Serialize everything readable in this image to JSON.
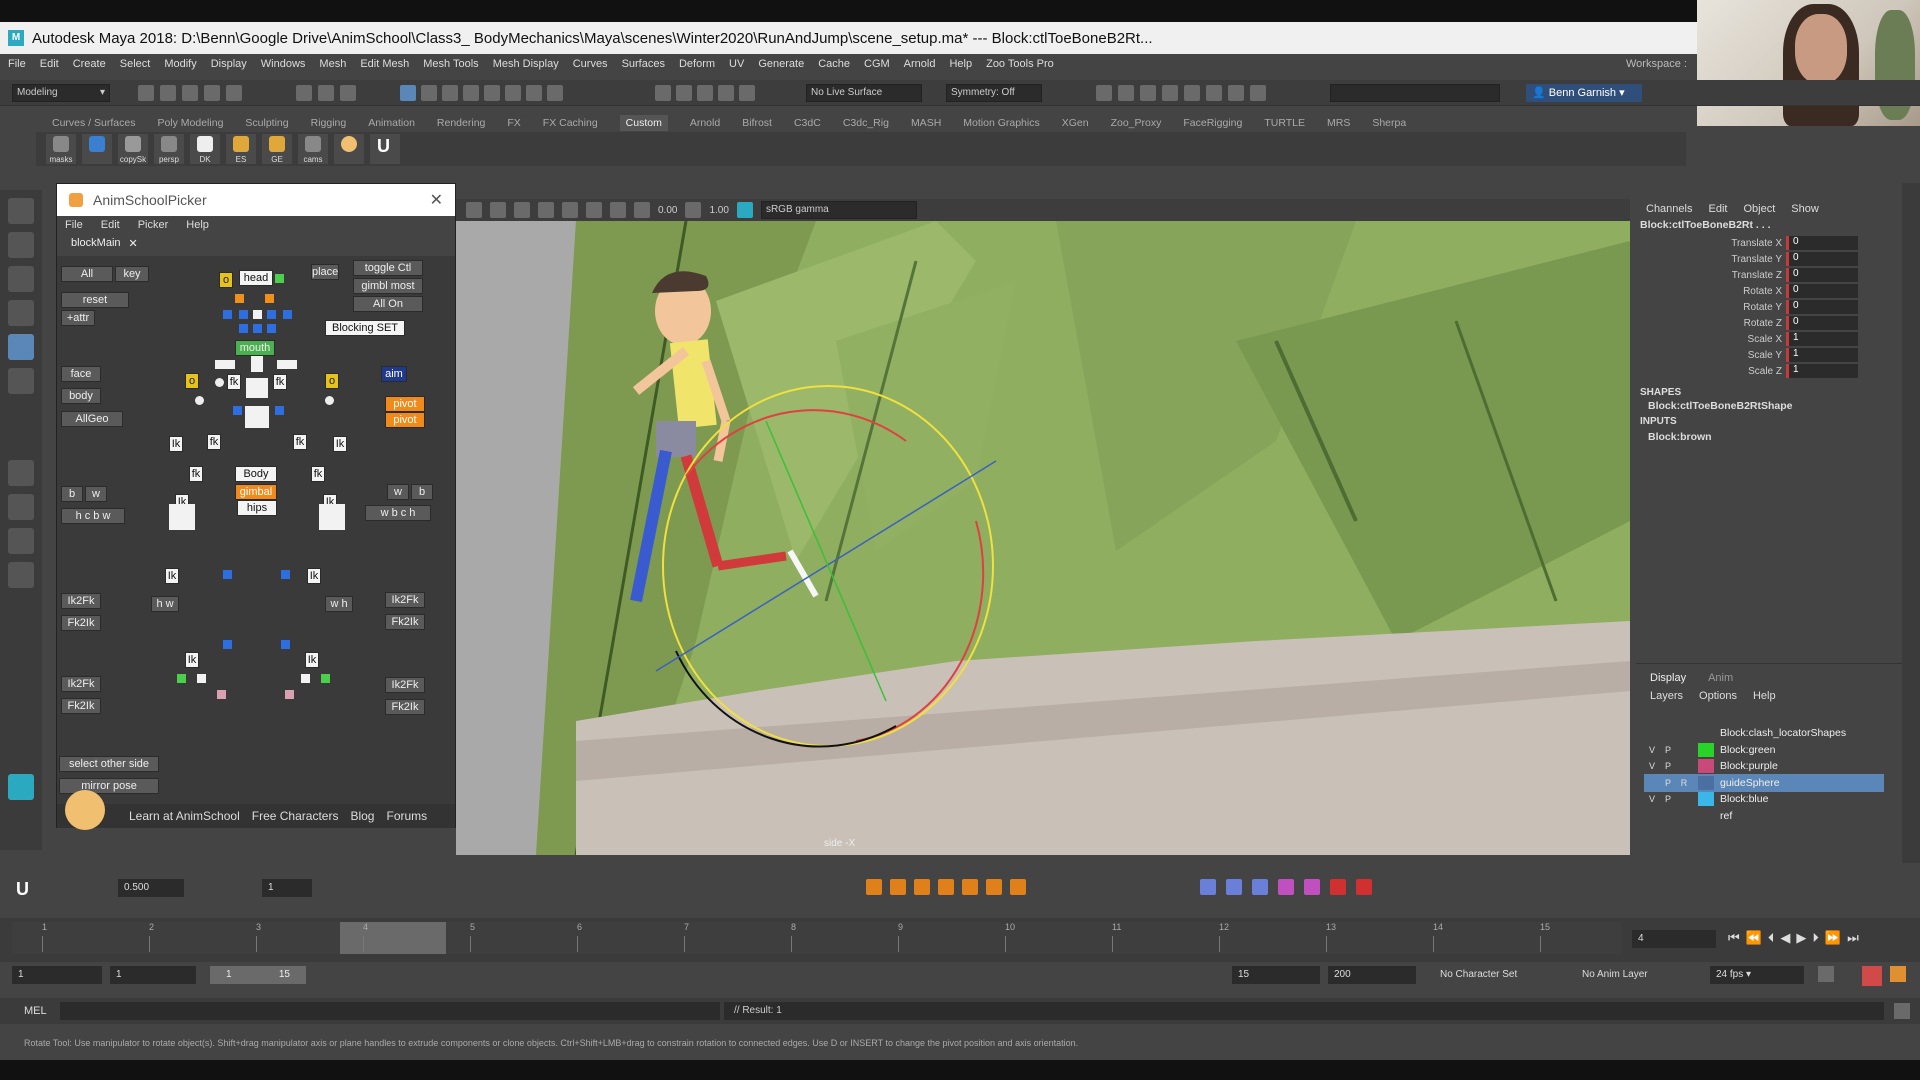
{
  "window": {
    "title": "Autodesk Maya 2018: D:\\Benn\\Google Drive\\AnimSchool\\Class3_ BodyMechanics\\Maya\\scenes\\Winter2020\\RunAndJump\\scene_setup.ma*   ---   Block:ctlToeBoneB2Rt..."
  },
  "menubar": [
    "File",
    "Edit",
    "Create",
    "Select",
    "Modify",
    "Display",
    "Windows",
    "Mesh",
    "Edit Mesh",
    "Mesh Tools",
    "Mesh Display",
    "Curves",
    "Surfaces",
    "Deform",
    "UV",
    "Generate",
    "Cache",
    "CGM",
    "Arnold",
    "Help",
    "Zoo Tools Pro"
  ],
  "workspace_label": "Workspace :",
  "statusline": {
    "mode": "Modeling",
    "live_surface": "No Live Surface",
    "symmetry": "Symmetry: Off",
    "user": "Benn Garnish"
  },
  "shelf_tabs": [
    "Curves / Surfaces",
    "Poly Modeling",
    "Sculpting",
    "Rigging",
    "Animation",
    "Rendering",
    "FX",
    "FX Caching",
    "Custom",
    "Arnold",
    "Bifrost",
    "C3dC",
    "C3dc_Rig",
    "MASH",
    "Motion Graphics",
    "XGen",
    "Zoo_Proxy",
    "FaceRigging",
    "TURTLE",
    "MRS",
    "Sherpa"
  ],
  "shelf_active": "Custom",
  "shelf_buttons": [
    "masks",
    "",
    "copySk",
    "persp",
    "DK",
    "ES",
    "GE",
    "cams",
    "",
    ""
  ],
  "picker": {
    "title": "AnimSchoolPicker",
    "menu": [
      "File",
      "Edit",
      "Picker",
      "Help"
    ],
    "tab": "blockMain",
    "buttons": {
      "all": "All",
      "key": "key",
      "reset": "reset",
      "attr": "+attr",
      "place": "place",
      "toggle": "toggle Ctl",
      "gimbl": "gimbl most",
      "allon": "All On",
      "blocking": "Blocking SET",
      "head": "head",
      "mouth": "mouth",
      "face": "face",
      "body": "body",
      "allgeo": "AllGeo",
      "aim": "aim",
      "pivot1": "pivot",
      "pivot2": "pivot",
      "body_center": "Body",
      "gimbal": "gimbal",
      "hips": "hips",
      "b": "b",
      "w": "w",
      "hcbw": "h c b w",
      "wbch": "w b c h",
      "ik2fk_l1": "Ik2Fk",
      "fk2ik_l1": "Fk2Ik",
      "ik2fk_r1": "Ik2Fk",
      "fk2ik_r1": "Fk2Ik",
      "ik2fk_l2": "Ik2Fk",
      "fk2ik_l2": "Fk2Ik",
      "ik2fk_r2": "Ik2Fk",
      "fk2ik_r2": "Fk2Ik",
      "select_other": "select other side",
      "mirror": "mirror pose",
      "hw_l": "h w",
      "wh_r": "w h",
      "fk": "fk",
      "ik": "Ik",
      "o": "o"
    },
    "footer": [
      "Learn at AnimSchool",
      "Free Characters",
      "Blog",
      "Forums"
    ]
  },
  "viewport": {
    "exposure": "0.00",
    "gamma": "1.00",
    "colorspace": "sRGB gamma",
    "camera_label": "side -X"
  },
  "channelbox": {
    "menu": [
      "Channels",
      "Edit",
      "Object",
      "Show"
    ],
    "node": "Block:ctlToeBoneB2Rt . . .",
    "channels": [
      {
        "name": "Translate X",
        "value": "0"
      },
      {
        "name": "Translate Y",
        "value": "0"
      },
      {
        "name": "Translate Z",
        "value": "0"
      },
      {
        "name": "Rotate X",
        "value": "0"
      },
      {
        "name": "Rotate Y",
        "value": "0"
      },
      {
        "name": "Rotate Z",
        "value": "0"
      },
      {
        "name": "Scale X",
        "value": "1"
      },
      {
        "name": "Scale Y",
        "value": "1"
      },
      {
        "name": "Scale Z",
        "value": "1"
      }
    ],
    "shapes_header": "SHAPES",
    "shape": "Block:ctlToeBoneB2RtShape",
    "inputs_header": "INPUTS",
    "input": "Block:brown"
  },
  "layers": {
    "tabs": [
      "Display",
      "Anim"
    ],
    "menu": [
      "Layers",
      "Options",
      "Help"
    ],
    "rows": [
      {
        "v": "",
        "p": "",
        "r": "",
        "name": "Block:clash_locatorShapes",
        "color": "#444444"
      },
      {
        "v": "V",
        "p": "P",
        "r": "",
        "name": "Block:green",
        "color": "#28d428"
      },
      {
        "v": "V",
        "p": "P",
        "r": "",
        "name": "Block:purple",
        "color": "#c84a78"
      },
      {
        "v": "",
        "p": "P",
        "r": "R",
        "name": "guideSphere",
        "color": "#4a6fa0"
      },
      {
        "v": "V",
        "p": "P",
        "r": "",
        "name": "Block:blue",
        "color": "#3ab7e8"
      },
      {
        "v": "",
        "p": "",
        "r": "",
        "name": "ref",
        "color": "#444444"
      }
    ]
  },
  "animbar": {
    "value1": "0.500",
    "value2": "1"
  },
  "timeline": {
    "ticks": [
      "1",
      "2",
      "3",
      "4",
      "5",
      "6",
      "7",
      "8",
      "9",
      "10",
      "11",
      "12",
      "13",
      "14",
      "15"
    ],
    "current_frame": "4"
  },
  "range": {
    "start": "1",
    "start2": "1",
    "range_start": "1",
    "range_end": "15",
    "end": "15",
    "end2": "200",
    "character_set": "No Character Set",
    "anim_layer": "No Anim Layer",
    "fps": "24 fps"
  },
  "cmdline": {
    "label": "MEL",
    "result": "// Result: 1"
  },
  "helpline": "Rotate Tool: Use manipulator to rotate object(s). Shift+drag manipulator axis or plane handles to extrude components or clone objects. Ctrl+Shift+LMB+drag to constrain rotation to connected edges. Use D or INSERT to change the pivot position and axis orientation."
}
